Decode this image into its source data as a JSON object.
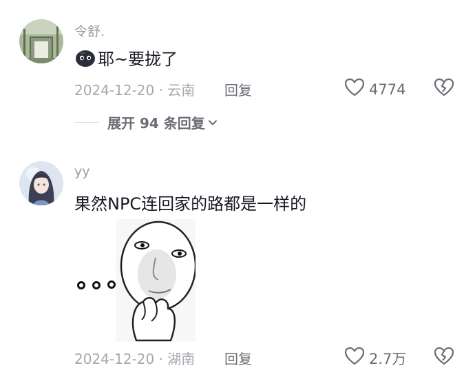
{
  "comments": [
    {
      "username": "令舒.",
      "emoji_name": "black-blob-emoji",
      "text": "耶~要拢了",
      "date_location": "2024-12-20 · 云南",
      "reply_label": "回复",
      "like_count": "4774",
      "expand_label": "展开 94 条回复"
    },
    {
      "username": "yy",
      "text": "果然NPC连回家的路都是一样的",
      "sticker_name": "thinking-meme-sticker",
      "date_location": "2024-12-20 · 湖南",
      "reply_label": "回复",
      "like_count": "2.7万"
    }
  ],
  "icons": {
    "like": "heart-outline-icon",
    "dislike": "broken-heart-icon",
    "expand": "chevron-down-icon"
  },
  "colors": {
    "primary_text": "#161823",
    "secondary_text": "#a6a7ad",
    "action_text": "#6b6d74"
  }
}
